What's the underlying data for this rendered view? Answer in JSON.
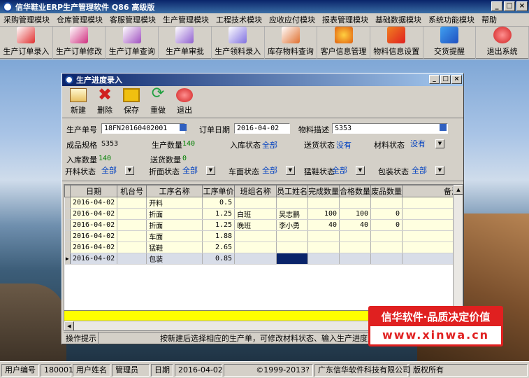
{
  "app": {
    "title": "信华鞋业ERP生产管理软件  Q86 高级版",
    "window_buttons": [
      "_",
      "□",
      "×"
    ]
  },
  "menu": [
    "采购管理模块",
    "仓库管理模块",
    "客服管理模块",
    "生产管理模块",
    "工程技术模块",
    "应收应付模块",
    "报表管理模块",
    "基础数据模块",
    "系统功能模块",
    "帮助"
  ],
  "toolbar": [
    "生产订单录入",
    "生产订单修改",
    "生产订单查询",
    "生产单审批",
    "生产领料录入",
    "库存物料查询",
    "客户信息管理",
    "物料信息设置",
    "交货提醒",
    "退出系统"
  ],
  "child": {
    "title": "生产进度录入",
    "tools": [
      "新建",
      "删除",
      "保存",
      "重做",
      "退出"
    ],
    "form": {
      "prod_no_label": "生产单号",
      "prod_no": "18FN20160402001",
      "order_date_label": "订单日期",
      "order_date": "2016-04-02",
      "material_desc_label": "物料描述",
      "material_desc": "S353",
      "spec_label": "成品规格",
      "spec": "S353",
      "qty_label": "生产数量",
      "qty": "140",
      "instock_status_label": "入库状态",
      "instock_status": "全部",
      "delivery_status_label": "送货状态",
      "delivery_status": "没有",
      "material_status_label": "材料状态",
      "material_status": "没有",
      "instock_qty_label": "入库数量",
      "instock_qty": "140",
      "delivery_qty_label": "送货数量",
      "delivery_qty": "0",
      "cut_status_label": "开料状态",
      "cut_status": "全部",
      "fold_status_label": "折面状态",
      "fold_status": "全部",
      "sew_status_label": "车面状态",
      "sew_status": "全部",
      "last_status_label": "猛鞋状态",
      "last_status": "全部",
      "pack_status_label": "包装状态",
      "pack_status": "全部"
    },
    "columns": [
      "日期",
      "机台号",
      "工序名称",
      "工序单价",
      "班组名称",
      "员工姓名",
      "完成数量",
      "合格数量",
      "废品数量",
      "备注"
    ],
    "rows": [
      [
        "2016-04-02",
        "",
        "开料",
        "0.5",
        "",
        "",
        "",
        "",
        "",
        ""
      ],
      [
        "2016-04-02",
        "",
        "折面",
        "1.25",
        "白班",
        "吴志鹏",
        "100",
        "100",
        "0",
        ""
      ],
      [
        "2016-04-02",
        "",
        "折面",
        "1.25",
        "晚班",
        "李小勇",
        "40",
        "40",
        "0",
        ""
      ],
      [
        "2016-04-02",
        "",
        "车面",
        "1.88",
        "",
        "",
        "",
        "",
        "",
        ""
      ],
      [
        "2016-04-02",
        "",
        "猛鞋",
        "2.65",
        "",
        "",
        "",
        "",
        "",
        ""
      ],
      [
        "2016-04-02",
        "",
        "包装",
        "0.85",
        "",
        "",
        "",
        "",
        "",
        ""
      ]
    ],
    "hint_label": "操作提示",
    "hint_text": "按新建后选择相应的生产单，可修改材料状态、输入生产进度及生产"
  },
  "banner": {
    "line1": "信华软件·品质决定价值",
    "line2": "www.xinwa.cn"
  },
  "status": {
    "user_no_label": "用户编号",
    "user_no": "180001",
    "user_name_label": "用户姓名",
    "user_name": "管理员",
    "date_label": "日期",
    "date": "2016-04-02",
    "copyright": "©1999-2013?",
    "company": "广东信华软件科技有限公司",
    "rights": "版权所有"
  },
  "colors": {
    "title_bar": "#0a246a",
    "accent_red": "#e02020",
    "grid_highlight": "#ffff00"
  },
  "icons": [
    "pdf-icon",
    "doc-icon",
    "query-icon",
    "approve-icon",
    "material-icon",
    "search-icon",
    "user-icon",
    "gear-icon",
    "bell-icon",
    "exit-icon"
  ]
}
